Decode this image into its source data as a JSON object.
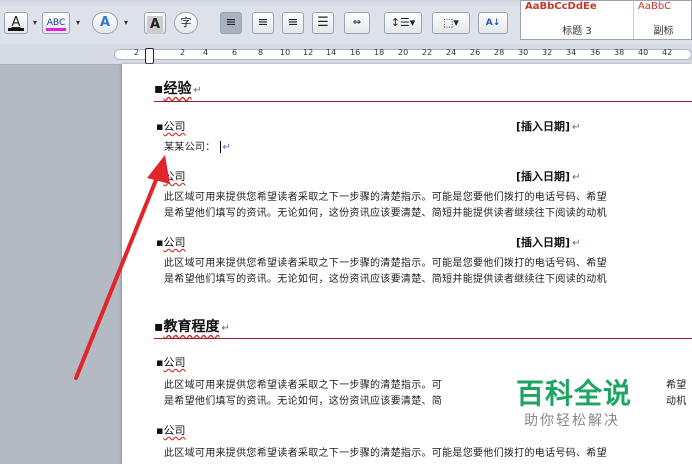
{
  "toolbar": {
    "font_color_glyph": "A",
    "highlight_glyph": "ABC",
    "text_effect_glyph": "A",
    "char_shading_glyph": "A",
    "enclose_glyph": "字",
    "sort_glyph": "A↓"
  },
  "styles": [
    {
      "preview": "AaBbCcDdEe",
      "name": "标题 3"
    },
    {
      "preview": "AaBbC",
      "name": "副标"
    }
  ],
  "ruler": {
    "ticks": [
      "2",
      "2",
      "4",
      "6",
      "8",
      "10",
      "12",
      "14",
      "16",
      "18",
      "20",
      "22",
      "24",
      "26",
      "28",
      "30",
      "32",
      "34",
      "36",
      "38",
      "40",
      "42"
    ]
  },
  "document": {
    "section_experience": "经验",
    "section_education": "教育程度",
    "paragraph_mark": "↵",
    "jobs": [
      {
        "company": "公司",
        "date": "[插入日期]",
        "text": "某某公司：",
        "lines": []
      },
      {
        "company": "公司",
        "date": "[插入日期]",
        "lines": [
          "此区域可用来提供您希望读者采取之下一步骤的清楚指示。可能是您要他们拨打的电话号码、希望",
          "是希望他们填写的资讯。无论如何，这份资讯应该要清楚、简短并能提供读者继续往下阅读的动机"
        ]
      },
      {
        "company": "公司",
        "date": "[插入日期]",
        "lines": [
          "此区域可用来提供您希望读者采取之下一步骤的清楚指示。可能是您要他们拨打的电话号码、希望",
          "是希望他们填写的资讯。无论如何，这份资讯应该要清楚、简短并能提供读者继续往下阅读的动机"
        ]
      }
    ],
    "schools": [
      {
        "company": "公司",
        "lines": [
          "此区域可用来提供您希望读者采取之下一步骤的清楚指示。可",
          "是希望他们填写的资讯。无论如何，这份资讯应该要清楚、简"
        ],
        "tail": [
          "希望",
          "动机"
        ]
      },
      {
        "company": "公司",
        "lines": [
          "此区域可用来提供您希望读者采取之下一步骤的清楚指示。可能是您要他们拨打的电话号码、希望"
        ]
      }
    ]
  },
  "watermark": {
    "title": "百科全说",
    "subtitle": "助你轻松解决"
  },
  "annotation_color": "#e0252b"
}
